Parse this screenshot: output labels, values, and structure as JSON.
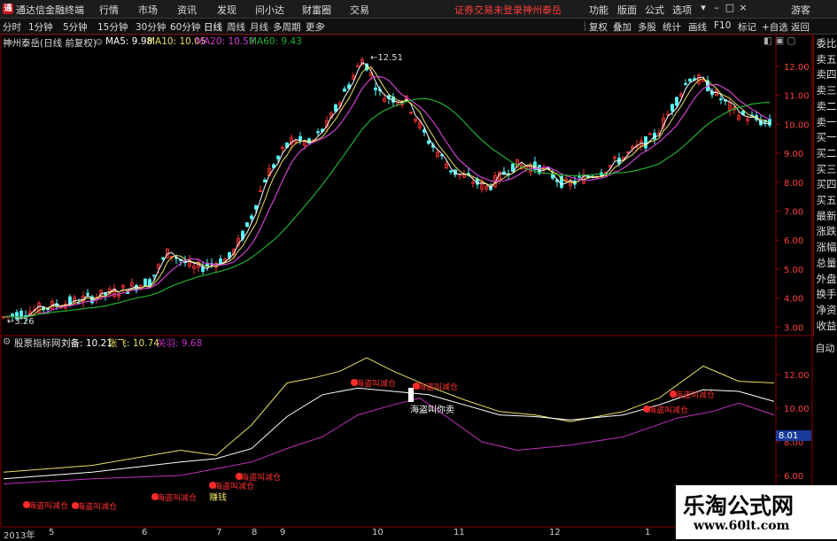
{
  "menu": {
    "app_title": "通达信金融终端",
    "items": [
      "行情",
      "市场",
      "资讯",
      "发现",
      "问小达",
      "财富圈",
      "交易"
    ],
    "alert": "证券交易未登录",
    "stock": "神州泰岳",
    "right_items": [
      "功能",
      "版面",
      "公式",
      "选项"
    ],
    "user": "游客"
  },
  "periods": [
    "分时",
    "1分钟",
    "5分钟",
    "15分钟",
    "30分钟",
    "60分钟",
    "日线",
    "周线",
    "月线",
    "多周期",
    "更多"
  ],
  "active_period": "日线",
  "toolbar": [
    "复权",
    "叠加",
    "多股",
    "统计",
    "画线",
    "F10",
    "标记",
    "+自选",
    "返回"
  ],
  "main_legend": {
    "stock_label": "神州泰岳(日线 前复权)",
    "ma5": "MA5: 9.98",
    "ma10": "MA10: 10.05",
    "ma20": "MA20: 10.59",
    "ma60": "MA60: 9.43"
  },
  "indicator_legend": {
    "name": "股票指标网",
    "liubei": "刘备: 10.21",
    "zhangfei": "张飞: 10.74",
    "guanyu": "关羽: 9.68"
  },
  "side_tabs": [
    "委比",
    "卖五",
    "卖四",
    "卖三",
    "卖二",
    "卖一",
    "买一",
    "买二",
    "买三",
    "买四",
    "买五",
    "最新",
    "涨跌",
    "涨幅",
    "总量",
    "外盘",
    "换手",
    "净资",
    "收益"
  ],
  "side_auto": "自动",
  "price_axis": [
    "12.00",
    "11.00",
    "10.00",
    "9.00",
    "8.00",
    "7.00",
    "6.00",
    "5.00",
    "4.00",
    "3.00"
  ],
  "indicator_axis": [
    "12.00",
    "10.00",
    "8.00",
    "6.00"
  ],
  "indicator_current": "8.01",
  "annotations": {
    "high": "12.51",
    "low": "3.26",
    "signal_reduce": "海盗叫减仓",
    "signal_sell": "海盗叫你卖",
    "signal_earn": "赚钱"
  },
  "x_axis": [
    "2013年",
    "5",
    "6",
    "7",
    "8",
    "9",
    "10",
    "11",
    "12",
    "1"
  ],
  "watermark": {
    "line1": "乐淘公式网",
    "line2": "www.60lt.com"
  },
  "colors": {
    "up": "#ff3232",
    "down": "#54ffff",
    "ma5": "#ffffff",
    "ma10": "#e8e060",
    "ma20": "#d040d0",
    "ma60": "#20b030",
    "liubei": "#ffffff",
    "zhangfei": "#e8e060",
    "guanyu": "#c030c0",
    "frame": "#880000"
  }
}
